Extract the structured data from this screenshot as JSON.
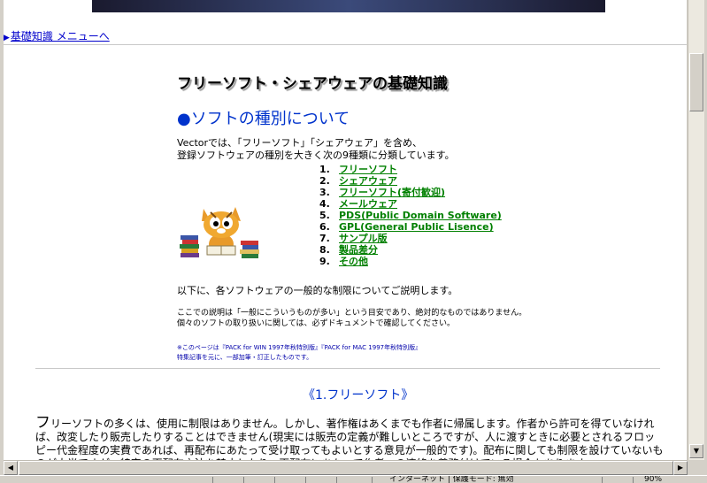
{
  "back_link": "基礎知識 メニューへ",
  "page_title": "フリーソフト・シェアウェアの基礎知識",
  "section_heading": "●ソフトの種別について",
  "intro": [
    "Vectorでは、「フリーソフト」「シェアウェア」を含め、",
    "登録ソフトウェアの種別を大きく次の9種類に分類しています。"
  ],
  "types": [
    {
      "num": "1.",
      "label": "フリーソフト"
    },
    {
      "num": "2.",
      "label": "シェアウェア"
    },
    {
      "num": "3.",
      "label": "フリーソフト(寄付歓迎)"
    },
    {
      "num": "4.",
      "label": "メールウェア"
    },
    {
      "num": "5.",
      "label": "PDS(Public Domain Software)"
    },
    {
      "num": "6.",
      "label": "GPL(General Public Lisence)"
    },
    {
      "num": "7.",
      "label": "サンプル版"
    },
    {
      "num": "8.",
      "label": "製品差分"
    },
    {
      "num": "9.",
      "label": "その他"
    }
  ],
  "below_text": "以下に、各ソフトウェアの一般的な制限についてご説明します。",
  "note1": [
    "ここでの説明は「一般にこういうものが多い」という目安であり、絶対的なものではありません。",
    "個々のソフトの取り扱いに関しては、必ずドキュメントで確認してください。"
  ],
  "note2": [
    "※このページは『PACK for WIN 1997年秋特別版』『PACK for MAC 1997年秋特別版』",
    "特集記事を元に、一部加筆・訂正したものです。"
  ],
  "sub_heading": "《1.フリーソフト》",
  "body_para_first": "フ",
  "body_para_rest": "リーソフトの多くは、使用に制限はありません。しかし、著作権はあくまでも作者に帰属します。作者から許可を得ていなければ、改変したり販売したりすることはできません(現実には販売の定義が難しいところですが、人に渡すときに必要とされるフロッピー代金程度の実費であれば、再配布にあたって受け取ってもよいとする意見が一般的です)。配布に関しても制限を設けていないものが大半ですが、特定の再配布方法を禁止したり、再配布にあたって作者への連絡を義務付けている場合もあります。",
  "status": {
    "zone": "インターネット | 保護モード: 無効",
    "zoom": "90%"
  },
  "colors": {
    "link": "#0000cc",
    "type_link": "#008000",
    "heading": "#0033cc"
  }
}
